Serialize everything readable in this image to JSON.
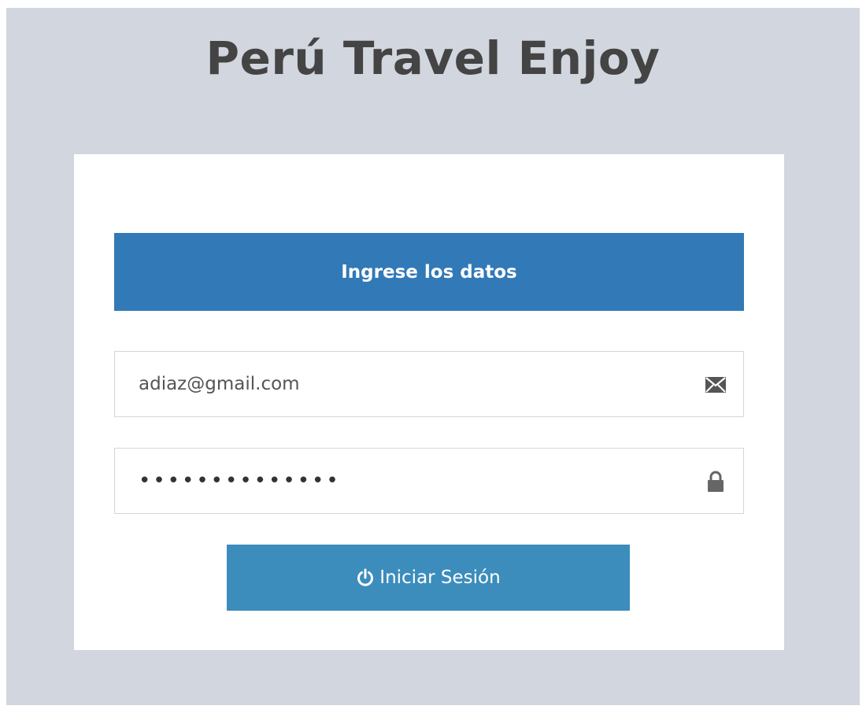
{
  "header": {
    "title": "Perú Travel Enjoy"
  },
  "login": {
    "heading": "Ingrese los datos",
    "email": {
      "value": "adiaz@gmail.com",
      "icon": "envelope-icon"
    },
    "password": {
      "value": "••••••••••••••",
      "icon": "lock-icon"
    },
    "submit": {
      "label": "Iniciar Sesión",
      "icon": "power-icon"
    }
  },
  "colors": {
    "page_background": "#d2d6de",
    "heading_background": "#3279b7",
    "button_background": "#3c8dbc",
    "title_text": "#444444"
  }
}
